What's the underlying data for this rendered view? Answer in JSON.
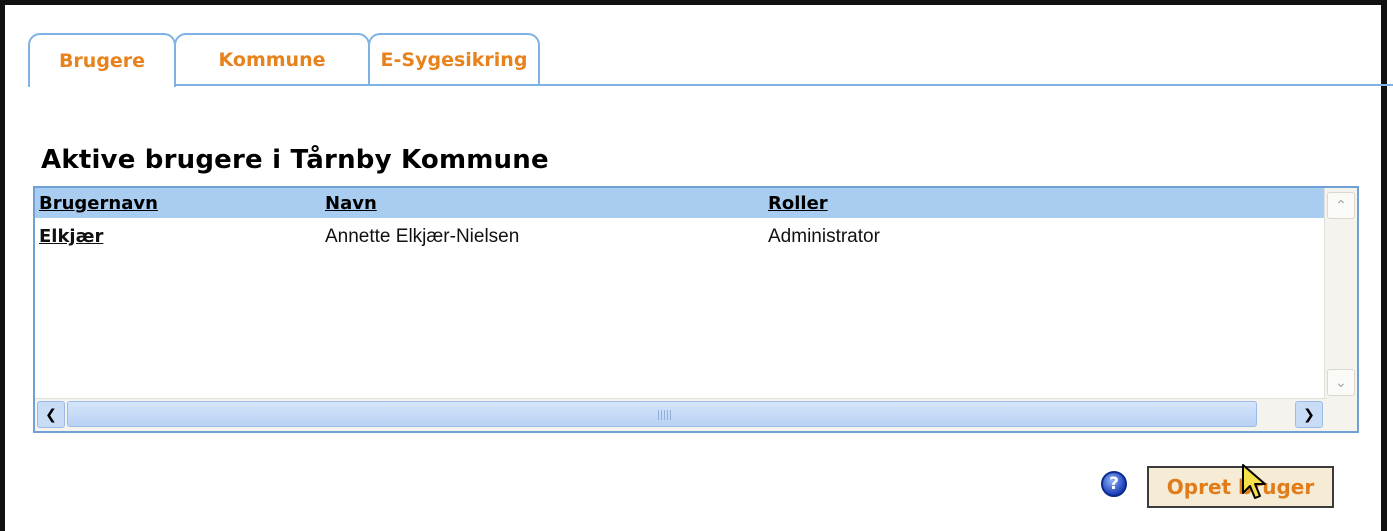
{
  "tabs": [
    {
      "label": "Brugere"
    },
    {
      "label": "Kommune"
    },
    {
      "label": "E-Sygesikring"
    }
  ],
  "heading": "Aktive brugere i Tårnby Kommune",
  "table": {
    "headers": [
      "Brugernavn",
      "Navn",
      "Roller"
    ],
    "rows": [
      [
        "Elkjær",
        "Annette Elkjær-Nielsen",
        "Administrator"
      ]
    ]
  },
  "help_label": "?",
  "create_button_label": "Opret bruger",
  "colors": {
    "accent": "#e8821c",
    "header_bg": "#a9cdf0",
    "border": "#7fb2e5"
  },
  "icons": [
    "help-icon",
    "scroll-up-icon",
    "scroll-down-icon",
    "scroll-left-icon",
    "scroll-right-icon",
    "mouse-cursor-icon"
  ]
}
